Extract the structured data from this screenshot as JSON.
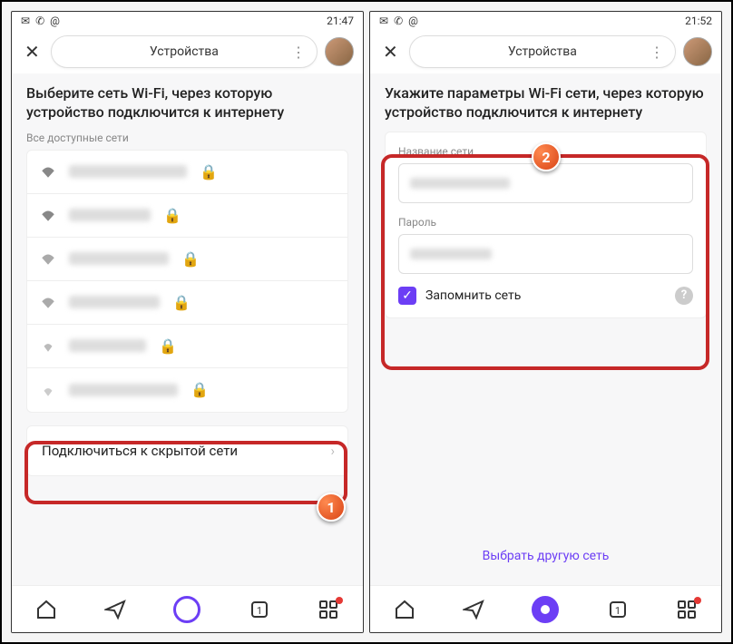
{
  "left": {
    "status": {
      "time": "21:47"
    },
    "header": {
      "title": "Устройства"
    },
    "heading": "Выберите сеть Wi-Fi, через которую устройство подключится к интернету",
    "list_label": "Все доступные сети",
    "hidden_network": "Подключиться к скрытой сети",
    "badge": "1"
  },
  "right": {
    "status": {
      "time": "21:52"
    },
    "header": {
      "title": "Устройства"
    },
    "heading": "Укажите параметры Wi-Fi сети, через которую устройство подключится к интернету",
    "field_network_label": "Название сети",
    "field_password_label": "Пароль",
    "remember_label": "Запомнить сеть",
    "other_network": "Выбрать другую сеть",
    "badge": "2"
  }
}
